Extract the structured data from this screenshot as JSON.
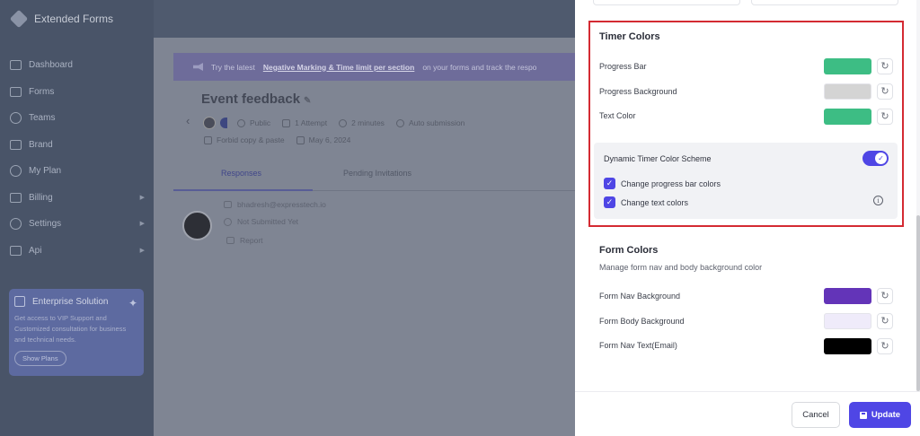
{
  "app": {
    "brand": "Extended Forms"
  },
  "sidebar": {
    "items": [
      {
        "label": "Dashboard",
        "icon": "dashboard-icon"
      },
      {
        "label": "Forms",
        "icon": "forms-icon"
      },
      {
        "label": "Teams",
        "icon": "teams-icon"
      },
      {
        "label": "Brand",
        "icon": "brand-icon"
      },
      {
        "label": "My Plan",
        "icon": "plan-icon"
      },
      {
        "label": "Billing",
        "icon": "billing-icon",
        "caret": "▶"
      },
      {
        "label": "Settings",
        "icon": "settings-icon",
        "caret": "▶"
      },
      {
        "label": "Api",
        "icon": "api-icon",
        "caret": "▶"
      }
    ],
    "enterprise": {
      "title": "Enterprise Solution",
      "text": "Get access to VIP Support and Customized consultation for business and technical needs.",
      "button": "Show Plans"
    }
  },
  "banner": {
    "prefix": "Try the latest",
    "link": "Negative Marking & Time limit per section",
    "suffix": "on your forms and track the respo"
  },
  "form": {
    "title": "Event feedback",
    "visibility": "Public",
    "attempts": "1 Attempt",
    "duration": "2 minutes",
    "submission": "Auto submission",
    "copy": "Forbid copy & paste",
    "date": "May 6, 2024"
  },
  "tabs": {
    "responses": "Responses",
    "pending": "Pending Invitations"
  },
  "response": {
    "email": "bhadresh@expresstech.io",
    "status": "Not Submitted Yet",
    "report": "Report"
  },
  "timer_colors": {
    "title": "Timer Colors",
    "rows": [
      {
        "label": "Progress Bar",
        "color": "#3dbd84"
      },
      {
        "label": "Progress Background",
        "color": "#d4d4d4"
      },
      {
        "label": "Text Color",
        "color": "#3dbd84"
      }
    ],
    "scheme": {
      "title": "Dynamic Timer Color Scheme",
      "enabled": true,
      "options": [
        {
          "label": "Change progress bar colors",
          "checked": true
        },
        {
          "label": "Change text colors",
          "checked": true
        }
      ]
    }
  },
  "form_colors": {
    "title": "Form Colors",
    "subtitle": "Manage form nav and body background color",
    "rows": [
      {
        "label": "Form Nav Background",
        "color": "#6334b8"
      },
      {
        "label": "Form Body Background",
        "color": "#efebfa"
      },
      {
        "label": "Form Nav Text(Email)",
        "color": "#000000"
      }
    ]
  },
  "footer": {
    "cancel": "Cancel",
    "update": "Update"
  },
  "colors": {
    "accent": "#4f46e5",
    "highlight_border": "#d42a32"
  }
}
